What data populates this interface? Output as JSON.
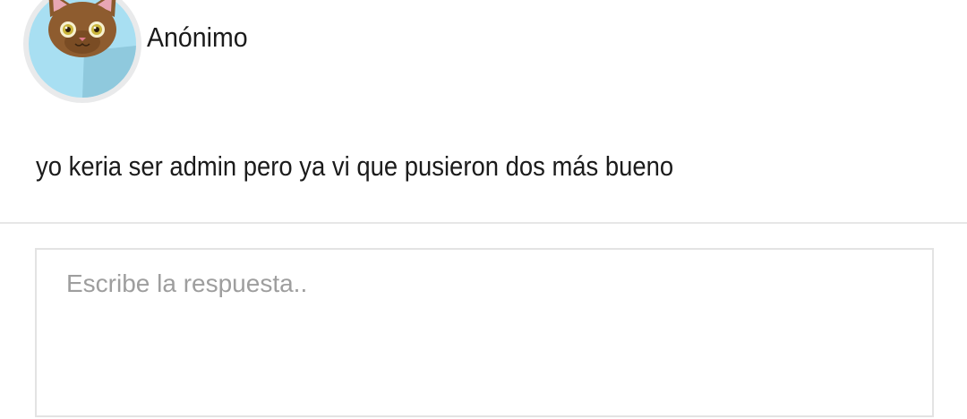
{
  "comment": {
    "author": "Anónimo",
    "avatar_icon": "cat-avatar-icon",
    "text": "yo keria ser admin pero ya vi que pusieron dos más bueno"
  },
  "reply": {
    "placeholder": "Escribe la respuesta..",
    "value": ""
  },
  "colors": {
    "avatar_bg": "#a8dff2",
    "text": "#1b1b1b",
    "placeholder": "#9e9e9e",
    "divider": "#e6e6e6"
  }
}
